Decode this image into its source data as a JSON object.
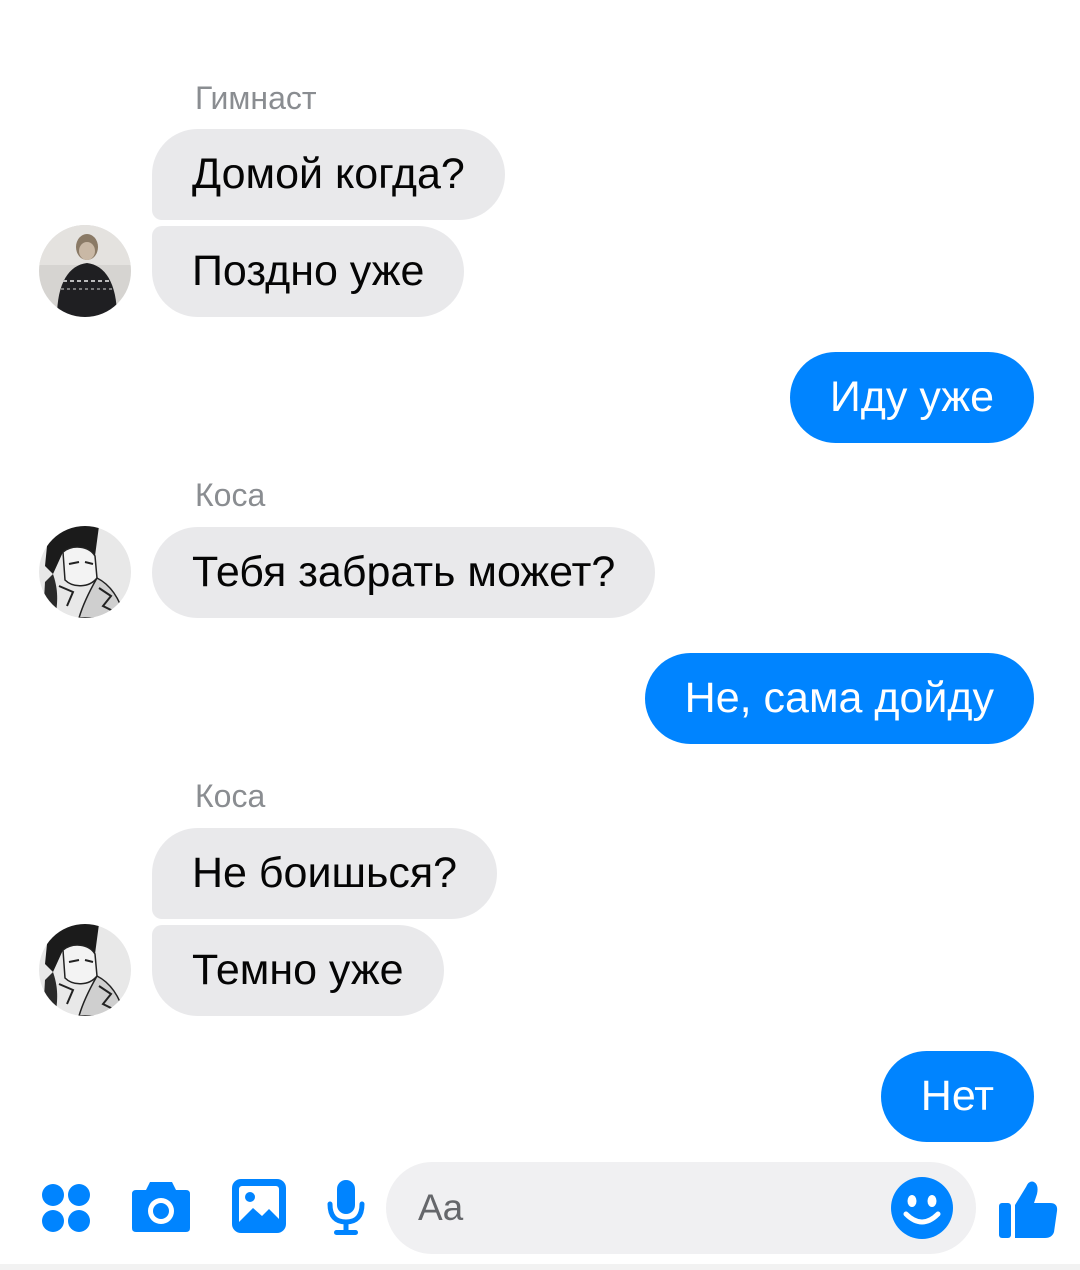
{
  "colors": {
    "outgoing_bubble": "#0084ff",
    "incoming_bubble": "#e9e9eb",
    "accent": "#0084ff",
    "sender_name": "#8a8d91"
  },
  "messages": [
    {
      "direction": "incoming",
      "sender": "Гимнаст",
      "avatar": "avatar-gymnast",
      "lines": [
        "Домой когда?",
        "Поздно уже"
      ]
    },
    {
      "direction": "outgoing",
      "lines": [
        "Иду уже"
      ]
    },
    {
      "direction": "incoming",
      "sender": "Коса",
      "avatar": "avatar-kosa",
      "lines": [
        "Тебя забрать может?"
      ]
    },
    {
      "direction": "outgoing",
      "lines": [
        "Не, сама дойду"
      ]
    },
    {
      "direction": "incoming",
      "sender": "Коса",
      "avatar": "avatar-kosa",
      "lines": [
        "Не боишься?",
        "Темно уже"
      ]
    },
    {
      "direction": "outgoing",
      "lines": [
        "Нет"
      ]
    }
  ],
  "composer": {
    "placeholder": "Aa",
    "icons": [
      "more-apps-icon",
      "camera-icon",
      "gallery-icon",
      "microphone-icon",
      "emoji-icon",
      "thumbs-up-icon"
    ]
  }
}
